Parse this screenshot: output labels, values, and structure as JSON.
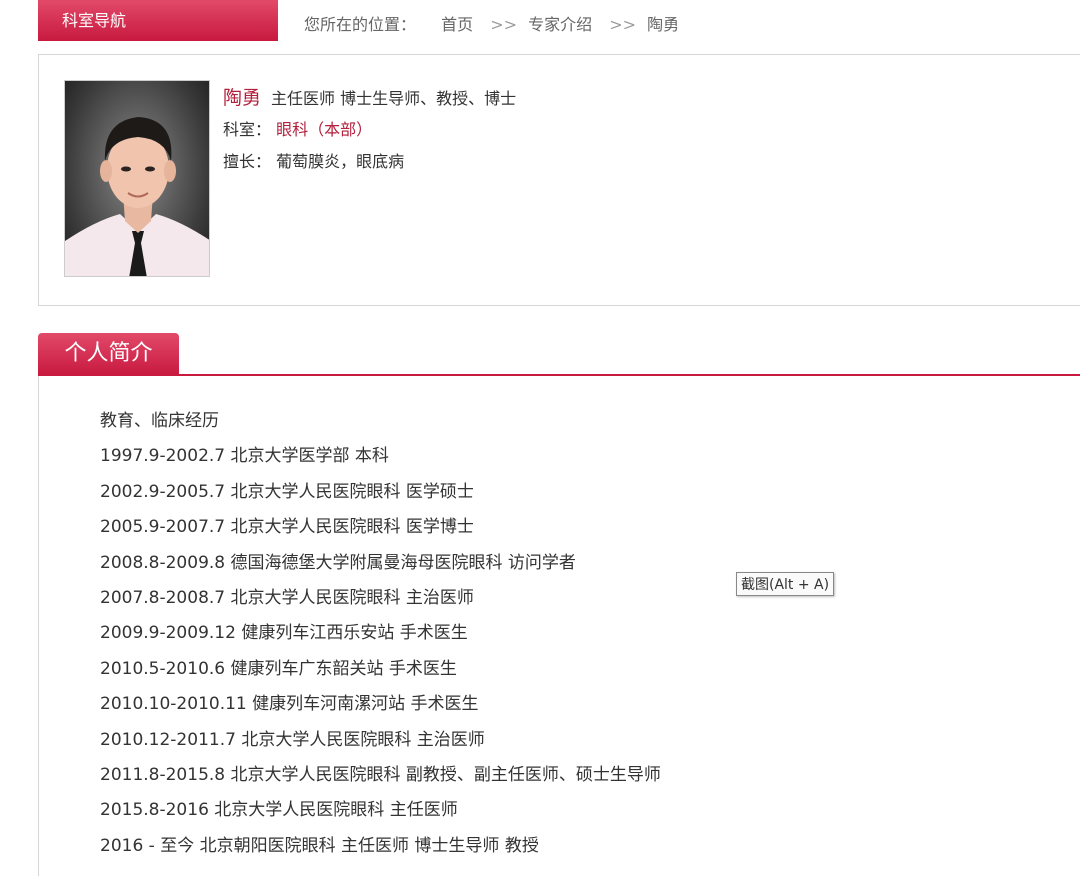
{
  "nav": {
    "label": "科室导航"
  },
  "breadcrumb": {
    "prefix": "您所在的位置：",
    "items": [
      "首页",
      "专家介绍",
      "陶勇"
    ],
    "separator": ">>"
  },
  "profile": {
    "name": "陶勇",
    "titles": "主任医师 博士生导师、教授、博士",
    "department_label": "科室：",
    "department": "眼科（本部）",
    "specialty_label": "擅长：",
    "specialty": "葡萄膜炎，眼底病"
  },
  "section": {
    "title": "个人简介"
  },
  "intro": {
    "lines": [
      "教育、临床经历",
      "1997.9-2002.7 北京大学医学部 本科",
      "2002.9-2005.7 北京大学人民医院眼科 医学硕士",
      "2005.9-2007.7 北京大学人民医院眼科 医学博士",
      "2008.8-2009.8 德国海德堡大学附属曼海母医院眼科 访问学者",
      "2007.8-2008.7 北京大学人民医院眼科 主治医师",
      "2009.9-2009.12 健康列车江西乐安站 手术医生",
      "2010.5-2010.6 健康列车广东韶关站 手术医生",
      "2010.10-2010.11 健康列车河南漯河站 手术医生",
      "2010.12-2011.7 北京大学人民医院眼科 主治医师",
      "2011.8-2015.8 北京大学人民医院眼科 副教授、副主任医师、硕士生导师",
      "2015.8-2016 北京大学人民医院眼科 主任医师",
      "2016 - 至今 北京朝阳医院眼科 主任医师 博士生导师 教授"
    ]
  },
  "tooltip": {
    "text": "截图(Alt + A)"
  }
}
